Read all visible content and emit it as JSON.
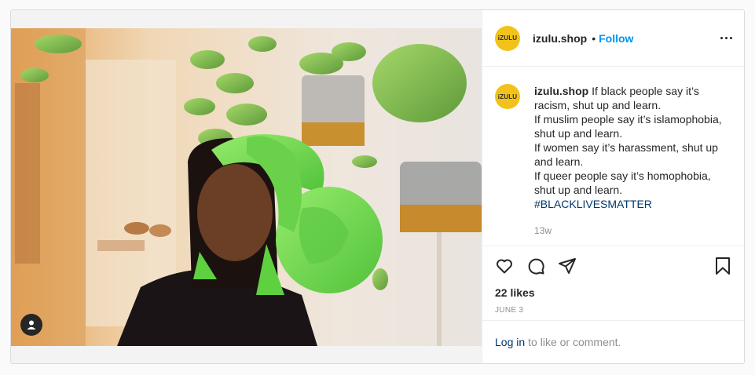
{
  "post": {
    "username": "izulu.shop",
    "avatar_text": "iZULU",
    "dot": "•",
    "follow_label": "Follow",
    "more_icon": "more-options-icon",
    "caption": {
      "username": "izulu.shop",
      "lines": [
        "If black people say it’s racism, shut up and learn.",
        "If muslim people say it’s islamophobia, shut up and learn.",
        "If women say it’s harassment, shut up and learn.",
        "If queer people say it’s homophobia, shut up and learn."
      ],
      "hashtag": "#BLACKLIVESMATTER",
      "age": "13w"
    },
    "actions": {
      "like_icon": "heart-icon",
      "comment_icon": "comment-icon",
      "share_icon": "share-icon",
      "save_icon": "bookmark-icon"
    },
    "likes": "22 likes",
    "date": "JUNE 3",
    "login": {
      "link": "Log in",
      "text": "to like or comment."
    }
  },
  "colors": {
    "accent": "#0095f6",
    "avatar_bg": "#f2c21b",
    "headscarf": "#7fe05a",
    "hashtag": "#00376b"
  }
}
